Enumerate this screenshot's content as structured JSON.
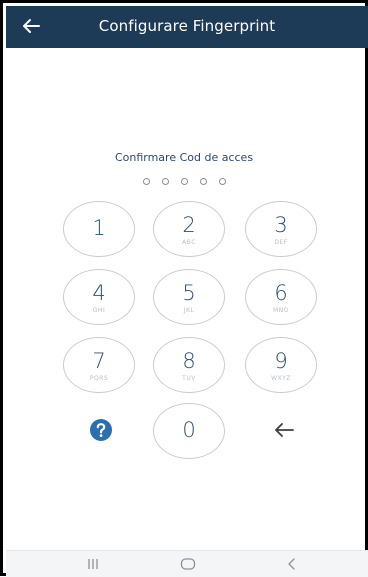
{
  "header": {
    "title": "Configurare Fingerprint",
    "back_icon": "arrow-left-icon",
    "background_color": "#1d3a57"
  },
  "pin": {
    "prompt": "Confirmare Cod de acces",
    "length": 5,
    "filled": 0
  },
  "keypad": {
    "keys": [
      {
        "digit": "1",
        "letters": ""
      },
      {
        "digit": "2",
        "letters": "ABC"
      },
      {
        "digit": "3",
        "letters": "DEF"
      },
      {
        "digit": "4",
        "letters": "GHI"
      },
      {
        "digit": "5",
        "letters": "JKL"
      },
      {
        "digit": "6",
        "letters": "MNO"
      },
      {
        "digit": "7",
        "letters": "PQRS"
      },
      {
        "digit": "8",
        "letters": "TUV"
      },
      {
        "digit": "9",
        "letters": "WXYZ"
      },
      {
        "digit": "0",
        "letters": ""
      }
    ],
    "help_icon": "help-circle-icon",
    "backspace_icon": "backspace-arrow-icon",
    "digit_color": "#2f4f6e",
    "help_color": "#2a6fb0"
  },
  "navbar": {
    "recents_icon": "recents-icon",
    "home_icon": "home-icon",
    "back_icon": "nav-back-icon"
  }
}
